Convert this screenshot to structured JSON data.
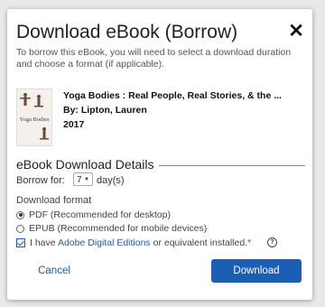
{
  "dialog": {
    "title": "Download eBook (Borrow)",
    "intro": "To borrow this eBook, you will need to select a download duration and choose a format (if applicable)."
  },
  "book": {
    "title": "Yoga Bodies : Real People, Real Stories, & the ...",
    "author": "By: Lipton, Lauren",
    "year": "2017",
    "cover_text": "Yoga Bodies"
  },
  "details": {
    "heading": "eBook Download Details",
    "borrow_label": "Borrow for:",
    "borrow_value": "7",
    "borrow_unit": "day(s)"
  },
  "format": {
    "label": "Download format",
    "options": [
      {
        "label": "PDF (Recommended for desktop)",
        "selected": true
      },
      {
        "label": "EPUB (Recommended for mobile devices)",
        "selected": false
      }
    ]
  },
  "confirm": {
    "prefix": "I have ",
    "link": "Adobe Digital Editions",
    "suffix": " or equivalent installed.",
    "required": "*",
    "checked": true
  },
  "actions": {
    "cancel": "Cancel",
    "download": "Download"
  },
  "colors": {
    "accent": "#1a5fb4",
    "required": "#dd3333"
  }
}
